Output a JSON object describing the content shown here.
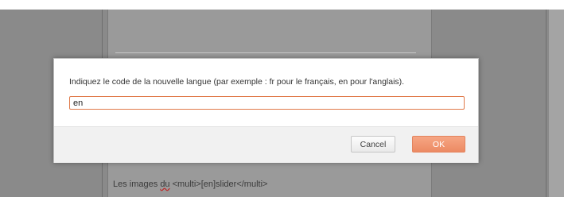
{
  "dialog": {
    "prompt": "Indiquez le code de la nouvelle langue (par exemple : fr pour le français, en pour l'anglais).",
    "input_value": "en",
    "cancel_label": "Cancel",
    "ok_label": "OK"
  },
  "background": {
    "text_before": "Les images ",
    "text_underlined": "du",
    "text_after": " <multi>[en]slider</multi>"
  },
  "colors": {
    "accent": "#ec8a63",
    "input_border": "#e07a4a",
    "overlay": "#8a8a8a"
  }
}
